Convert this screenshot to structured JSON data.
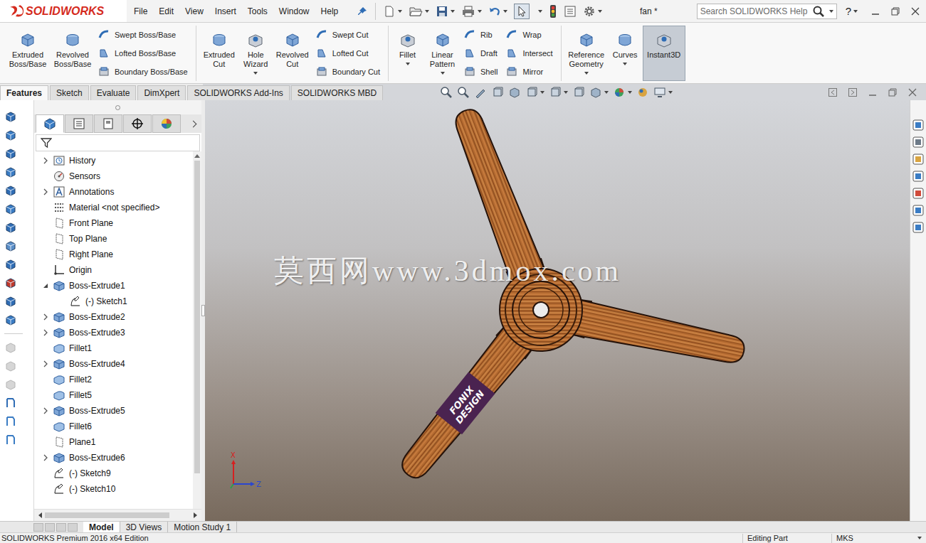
{
  "app": {
    "logo": "SOLIDWORKS",
    "document": "fan *",
    "search_placeholder": "Search SOLIDWORKS Help",
    "help": "?"
  },
  "menu": [
    "File",
    "Edit",
    "View",
    "Insert",
    "Tools",
    "Window",
    "Help"
  ],
  "ribbon_groups": [
    {
      "items": [
        {
          "kind": "large",
          "label": "Extruded Boss/Base",
          "dropdown": false,
          "selected": false
        },
        {
          "kind": "large",
          "label": "Revolved Boss/Base",
          "dropdown": false,
          "selected": false
        },
        {
          "kind": "stack",
          "entries": [
            {
              "label": "Swept Boss/Base"
            },
            {
              "label": "Lofted Boss/Base"
            },
            {
              "label": "Boundary Boss/Base"
            }
          ]
        }
      ]
    },
    {
      "items": [
        {
          "kind": "large",
          "label": "Extruded Cut",
          "dropdown": false,
          "selected": false
        },
        {
          "kind": "large",
          "label": "Hole Wizard",
          "dropdown": true,
          "selected": false
        },
        {
          "kind": "large",
          "label": "Revolved Cut",
          "dropdown": false,
          "selected": false
        },
        {
          "kind": "stack",
          "entries": [
            {
              "label": "Swept Cut"
            },
            {
              "label": "Lofted Cut"
            },
            {
              "label": "Boundary Cut"
            }
          ]
        }
      ]
    },
    {
      "items": [
        {
          "kind": "large",
          "label": "Fillet",
          "dropdown": true,
          "selected": false
        },
        {
          "kind": "large",
          "label": "Linear Pattern",
          "dropdown": true,
          "selected": false
        },
        {
          "kind": "stack",
          "entries": [
            {
              "label": "Rib"
            },
            {
              "label": "Draft"
            },
            {
              "label": "Shell"
            }
          ]
        },
        {
          "kind": "stack",
          "entries": [
            {
              "label": "Wrap"
            },
            {
              "label": "Intersect"
            },
            {
              "label": "Mirror"
            }
          ]
        }
      ]
    },
    {
      "items": [
        {
          "kind": "large",
          "label": "Reference Geometry",
          "dropdown": true,
          "selected": false
        },
        {
          "kind": "large",
          "label": "Curves",
          "dropdown": true,
          "selected": false
        },
        {
          "kind": "large",
          "label": "Instant3D",
          "dropdown": false,
          "selected": true
        }
      ]
    }
  ],
  "command_tabs": [
    {
      "label": "Features",
      "selected": true
    },
    {
      "label": "Sketch",
      "selected": false
    },
    {
      "label": "Evaluate",
      "selected": false
    },
    {
      "label": "DimXpert",
      "selected": false
    },
    {
      "label": "SOLIDWORKS Add-Ins",
      "selected": false
    },
    {
      "label": "SOLIDWORKS MBD",
      "selected": false
    }
  ],
  "panel_tabs": [
    {
      "kind": "features",
      "selected": true
    },
    {
      "kind": "properties",
      "selected": false
    },
    {
      "kind": "configurations",
      "selected": false
    },
    {
      "kind": "dimxpert",
      "selected": false
    },
    {
      "kind": "display",
      "selected": false
    }
  ],
  "tree": [
    {
      "label": "History",
      "kind": "history",
      "depth": 0,
      "expandable": true,
      "expanded": false
    },
    {
      "label": "Sensors",
      "kind": "sensors",
      "depth": 0,
      "expandable": false,
      "expanded": false
    },
    {
      "label": "Annotations",
      "kind": "annotations",
      "depth": 0,
      "expandable": true,
      "expanded": false
    },
    {
      "label": "Material <not specified>",
      "kind": "material",
      "depth": 0,
      "expandable": false,
      "expanded": false
    },
    {
      "label": "Front Plane",
      "kind": "plane",
      "depth": 0,
      "expandable": false,
      "expanded": false
    },
    {
      "label": "Top Plane",
      "kind": "plane",
      "depth": 0,
      "expandable": false,
      "expanded": false
    },
    {
      "label": "Right Plane",
      "kind": "plane",
      "depth": 0,
      "expandable": false,
      "expanded": false
    },
    {
      "label": "Origin",
      "kind": "origin",
      "depth": 0,
      "expandable": false,
      "expanded": false
    },
    {
      "label": "Boss-Extrude1",
      "kind": "extrude",
      "depth": 0,
      "expandable": true,
      "expanded": true
    },
    {
      "label": "(-) Sketch1",
      "kind": "sketch",
      "depth": 1,
      "expandable": false,
      "expanded": false
    },
    {
      "label": "Boss-Extrude2",
      "kind": "extrude",
      "depth": 0,
      "expandable": true,
      "expanded": false
    },
    {
      "label": "Boss-Extrude3",
      "kind": "extrude",
      "depth": 0,
      "expandable": true,
      "expanded": false
    },
    {
      "label": "Fillet1",
      "kind": "fillet",
      "depth": 0,
      "expandable": false,
      "expanded": false
    },
    {
      "label": "Boss-Extrude4",
      "kind": "extrude",
      "depth": 0,
      "expandable": true,
      "expanded": false
    },
    {
      "label": "Fillet2",
      "kind": "fillet",
      "depth": 0,
      "expandable": false,
      "expanded": false
    },
    {
      "label": "Fillet5",
      "kind": "fillet",
      "depth": 0,
      "expandable": false,
      "expanded": false
    },
    {
      "label": "Boss-Extrude5",
      "kind": "extrude",
      "depth": 0,
      "expandable": true,
      "expanded": false
    },
    {
      "label": "Fillet6",
      "kind": "fillet",
      "depth": 0,
      "expandable": false,
      "expanded": false
    },
    {
      "label": "Plane1",
      "kind": "plane",
      "depth": 0,
      "expandable": false,
      "expanded": false
    },
    {
      "label": "Boss-Extrude6",
      "kind": "extrude",
      "depth": 0,
      "expandable": true,
      "expanded": false
    },
    {
      "label": "(-) Sketch9",
      "kind": "sketch",
      "depth": 0,
      "expandable": false,
      "expanded": false
    },
    {
      "label": "(-) Sketch10",
      "kind": "sketch",
      "depth": 0,
      "expandable": false,
      "expanded": false
    }
  ],
  "viewport": {
    "watermark": "莫西网www.3dmox.com",
    "decal": [
      "FONIX",
      "DESIGN"
    ],
    "axes": [
      {
        "label": "X",
        "color": "#d62020"
      },
      {
        "label": "Z",
        "color": "#2a46d0"
      }
    ]
  },
  "bottom_tabs": [
    {
      "label": "Model",
      "selected": true
    },
    {
      "label": "3D Views",
      "selected": false
    },
    {
      "label": "Motion Study 1",
      "selected": false
    }
  ],
  "status_bar": {
    "edition": "SOLIDWORKS Premium 2016 x64 Edition",
    "mode": "Editing Part",
    "units": "MKS"
  }
}
